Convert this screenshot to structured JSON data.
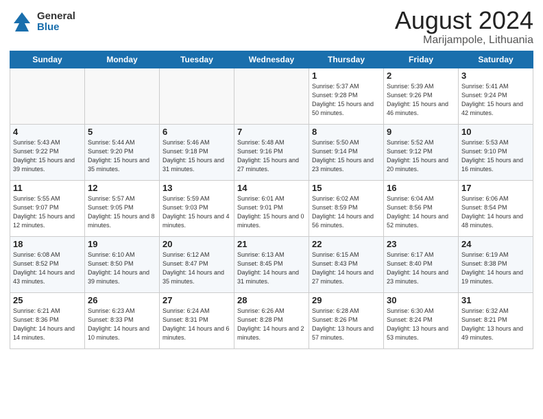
{
  "header": {
    "logo_general": "General",
    "logo_blue": "Blue",
    "month_year": "August 2024",
    "location": "Marijampole, Lithuania"
  },
  "days_of_week": [
    "Sunday",
    "Monday",
    "Tuesday",
    "Wednesday",
    "Thursday",
    "Friday",
    "Saturday"
  ],
  "weeks": [
    [
      {
        "num": "",
        "info": "",
        "empty": true
      },
      {
        "num": "",
        "info": "",
        "empty": true
      },
      {
        "num": "",
        "info": "",
        "empty": true
      },
      {
        "num": "",
        "info": "",
        "empty": true
      },
      {
        "num": "1",
        "info": "Sunrise: 5:37 AM\nSunset: 9:28 PM\nDaylight: 15 hours\nand 50 minutes.",
        "empty": false
      },
      {
        "num": "2",
        "info": "Sunrise: 5:39 AM\nSunset: 9:26 PM\nDaylight: 15 hours\nand 46 minutes.",
        "empty": false
      },
      {
        "num": "3",
        "info": "Sunrise: 5:41 AM\nSunset: 9:24 PM\nDaylight: 15 hours\nand 42 minutes.",
        "empty": false
      }
    ],
    [
      {
        "num": "4",
        "info": "Sunrise: 5:43 AM\nSunset: 9:22 PM\nDaylight: 15 hours\nand 39 minutes.",
        "empty": false
      },
      {
        "num": "5",
        "info": "Sunrise: 5:44 AM\nSunset: 9:20 PM\nDaylight: 15 hours\nand 35 minutes.",
        "empty": false
      },
      {
        "num": "6",
        "info": "Sunrise: 5:46 AM\nSunset: 9:18 PM\nDaylight: 15 hours\nand 31 minutes.",
        "empty": false
      },
      {
        "num": "7",
        "info": "Sunrise: 5:48 AM\nSunset: 9:16 PM\nDaylight: 15 hours\nand 27 minutes.",
        "empty": false
      },
      {
        "num": "8",
        "info": "Sunrise: 5:50 AM\nSunset: 9:14 PM\nDaylight: 15 hours\nand 23 minutes.",
        "empty": false
      },
      {
        "num": "9",
        "info": "Sunrise: 5:52 AM\nSunset: 9:12 PM\nDaylight: 15 hours\nand 20 minutes.",
        "empty": false
      },
      {
        "num": "10",
        "info": "Sunrise: 5:53 AM\nSunset: 9:10 PM\nDaylight: 15 hours\nand 16 minutes.",
        "empty": false
      }
    ],
    [
      {
        "num": "11",
        "info": "Sunrise: 5:55 AM\nSunset: 9:07 PM\nDaylight: 15 hours\nand 12 minutes.",
        "empty": false
      },
      {
        "num": "12",
        "info": "Sunrise: 5:57 AM\nSunset: 9:05 PM\nDaylight: 15 hours\nand 8 minutes.",
        "empty": false
      },
      {
        "num": "13",
        "info": "Sunrise: 5:59 AM\nSunset: 9:03 PM\nDaylight: 15 hours\nand 4 minutes.",
        "empty": false
      },
      {
        "num": "14",
        "info": "Sunrise: 6:01 AM\nSunset: 9:01 PM\nDaylight: 15 hours\nand 0 minutes.",
        "empty": false
      },
      {
        "num": "15",
        "info": "Sunrise: 6:02 AM\nSunset: 8:59 PM\nDaylight: 14 hours\nand 56 minutes.",
        "empty": false
      },
      {
        "num": "16",
        "info": "Sunrise: 6:04 AM\nSunset: 8:56 PM\nDaylight: 14 hours\nand 52 minutes.",
        "empty": false
      },
      {
        "num": "17",
        "info": "Sunrise: 6:06 AM\nSunset: 8:54 PM\nDaylight: 14 hours\nand 48 minutes.",
        "empty": false
      }
    ],
    [
      {
        "num": "18",
        "info": "Sunrise: 6:08 AM\nSunset: 8:52 PM\nDaylight: 14 hours\nand 43 minutes.",
        "empty": false
      },
      {
        "num": "19",
        "info": "Sunrise: 6:10 AM\nSunset: 8:50 PM\nDaylight: 14 hours\nand 39 minutes.",
        "empty": false
      },
      {
        "num": "20",
        "info": "Sunrise: 6:12 AM\nSunset: 8:47 PM\nDaylight: 14 hours\nand 35 minutes.",
        "empty": false
      },
      {
        "num": "21",
        "info": "Sunrise: 6:13 AM\nSunset: 8:45 PM\nDaylight: 14 hours\nand 31 minutes.",
        "empty": false
      },
      {
        "num": "22",
        "info": "Sunrise: 6:15 AM\nSunset: 8:43 PM\nDaylight: 14 hours\nand 27 minutes.",
        "empty": false
      },
      {
        "num": "23",
        "info": "Sunrise: 6:17 AM\nSunset: 8:40 PM\nDaylight: 14 hours\nand 23 minutes.",
        "empty": false
      },
      {
        "num": "24",
        "info": "Sunrise: 6:19 AM\nSunset: 8:38 PM\nDaylight: 14 hours\nand 19 minutes.",
        "empty": false
      }
    ],
    [
      {
        "num": "25",
        "info": "Sunrise: 6:21 AM\nSunset: 8:36 PM\nDaylight: 14 hours\nand 14 minutes.",
        "empty": false
      },
      {
        "num": "26",
        "info": "Sunrise: 6:23 AM\nSunset: 8:33 PM\nDaylight: 14 hours\nand 10 minutes.",
        "empty": false
      },
      {
        "num": "27",
        "info": "Sunrise: 6:24 AM\nSunset: 8:31 PM\nDaylight: 14 hours\nand 6 minutes.",
        "empty": false
      },
      {
        "num": "28",
        "info": "Sunrise: 6:26 AM\nSunset: 8:28 PM\nDaylight: 14 hours\nand 2 minutes.",
        "empty": false
      },
      {
        "num": "29",
        "info": "Sunrise: 6:28 AM\nSunset: 8:26 PM\nDaylight: 13 hours\nand 57 minutes.",
        "empty": false
      },
      {
        "num": "30",
        "info": "Sunrise: 6:30 AM\nSunset: 8:24 PM\nDaylight: 13 hours\nand 53 minutes.",
        "empty": false
      },
      {
        "num": "31",
        "info": "Sunrise: 6:32 AM\nSunset: 8:21 PM\nDaylight: 13 hours\nand 49 minutes.",
        "empty": false
      }
    ]
  ]
}
